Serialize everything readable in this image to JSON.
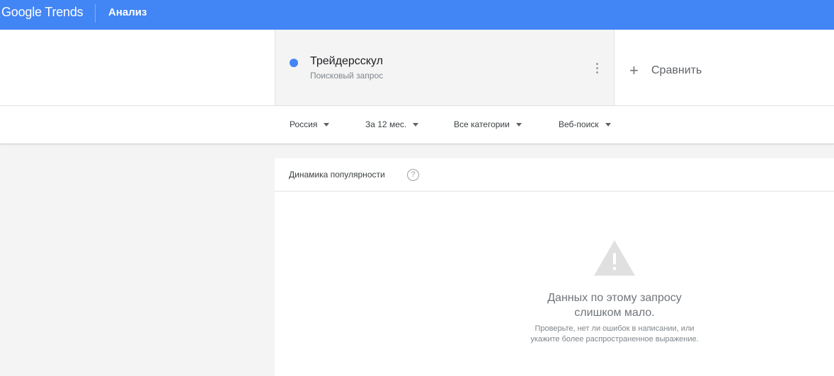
{
  "header": {
    "logo_text": "Google Trends",
    "section_title": "Анализ",
    "background_color": "#4285f4"
  },
  "term": {
    "name": "Трейдерсскул",
    "type": "Поисковый запрос",
    "dot_color": "#4285f4",
    "menu_icon": "more-vert-icon"
  },
  "compare": {
    "icon": "plus-icon",
    "label": "Сравнить"
  },
  "filters": [
    {
      "label": "Россия"
    },
    {
      "label": "За 12 мес."
    },
    {
      "label": "Все категории"
    },
    {
      "label": "Веб-поиск"
    }
  ],
  "card": {
    "title": "Динамика популярности",
    "help_icon": "help-icon",
    "warning_icon": "warning-icon",
    "empty_title_line1": "Данных по этому запросу",
    "empty_title_line2": "слишком мало.",
    "empty_sub_line1": "Проверьте, нет ли ошибок в написании, или",
    "empty_sub_line2": "укажите более распространенное выражение."
  }
}
